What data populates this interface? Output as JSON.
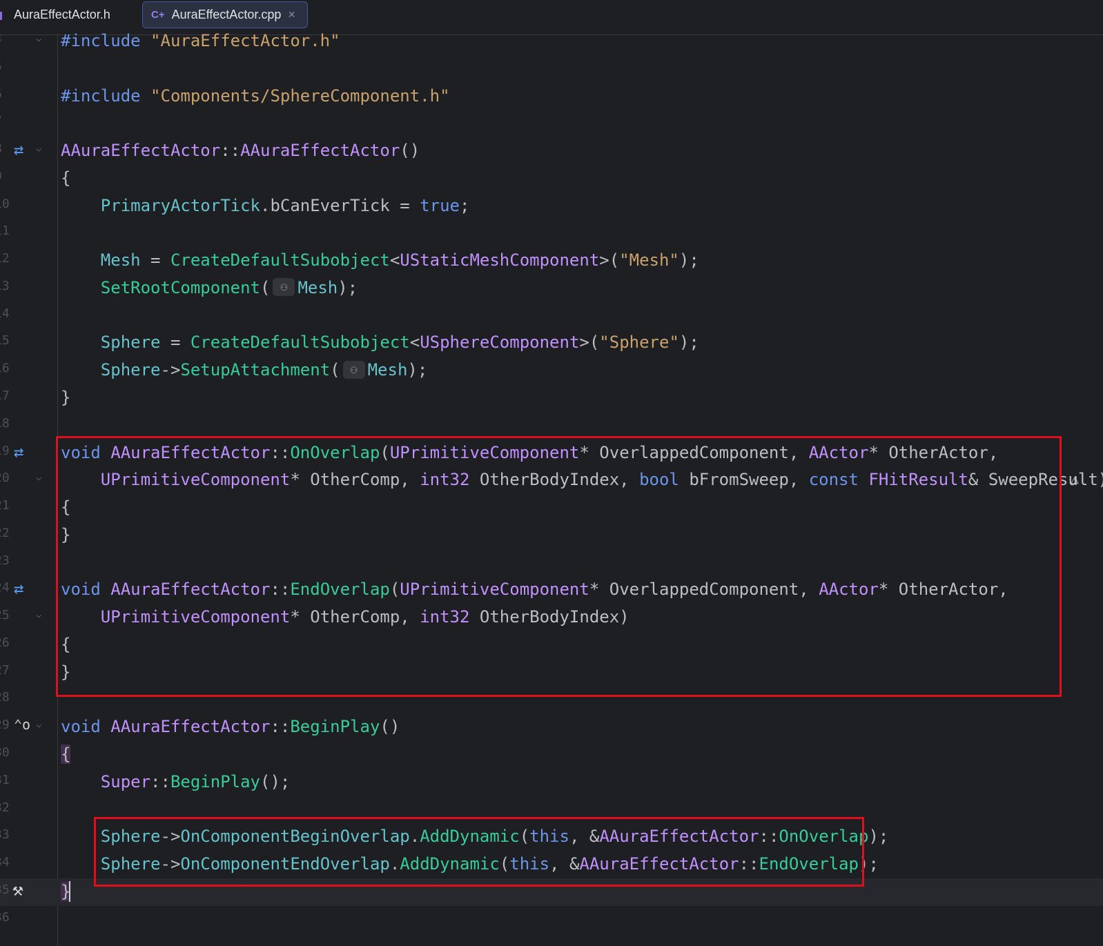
{
  "tabs": [
    {
      "label": "AuraEffectActor.h",
      "icon": "header-file-icon",
      "active": false
    },
    {
      "label": "AuraEffectActor.cpp",
      "icon": "cpp-file-icon",
      "active": true,
      "close": "×",
      "icon_text": "C+"
    }
  ],
  "colors": {
    "keyword": "#6c95eb",
    "type": "#c191ff",
    "function": "#39cc9b",
    "member": "#66c3cc",
    "string": "#c9a26d",
    "highlight_box": "#e00f1e"
  },
  "editor": {
    "lines": [
      {
        "num": "4",
        "fold": true,
        "tokens": [
          [
            "pp",
            "#include "
          ],
          [
            "str",
            "\"AuraEffectActor.h\""
          ]
        ]
      },
      {
        "num": "5",
        "tokens": []
      },
      {
        "num": "6",
        "tokens": [
          [
            "pp",
            "#include "
          ],
          [
            "str",
            "\"Components/SphereComponent.h\""
          ]
        ]
      },
      {
        "num": "7",
        "tokens": []
      },
      {
        "num": "8",
        "gutter": "implements-icon",
        "fold": true,
        "tokens": [
          [
            "ty",
            "AAuraEffectActor"
          ],
          [
            "txt",
            "::"
          ],
          [
            "ty",
            "AAuraEffectActor"
          ],
          [
            "txt",
            "()"
          ]
        ]
      },
      {
        "num": "9",
        "tokens": [
          [
            "txt",
            "{"
          ]
        ]
      },
      {
        "num": "10",
        "tokens": [
          [
            "txt",
            "    "
          ],
          [
            "mem",
            "PrimaryActorTick"
          ],
          [
            "txt",
            "."
          ],
          [
            "prm",
            "bCanEverTick"
          ],
          [
            "txt",
            " = "
          ],
          [
            "kw",
            "true"
          ],
          [
            "txt",
            ";"
          ]
        ]
      },
      {
        "num": "11",
        "tokens": []
      },
      {
        "num": "12",
        "tokens": [
          [
            "txt",
            "    "
          ],
          [
            "mem",
            "Mesh"
          ],
          [
            "txt",
            " = "
          ],
          [
            "fn",
            "CreateDefaultSubobject"
          ],
          [
            "txt",
            "<"
          ],
          [
            "ty",
            "UStaticMeshComponent"
          ],
          [
            "txt",
            ">("
          ],
          [
            "str",
            "\"Mesh\""
          ],
          [
            "txt",
            ");"
          ]
        ]
      },
      {
        "num": "13",
        "tokens": [
          [
            "txt",
            "    "
          ],
          [
            "fn",
            "SetRootComponent"
          ],
          [
            "txt",
            "("
          ],
          [
            "hint",
            "⚇"
          ],
          [
            "mem",
            "Mesh"
          ],
          [
            "txt",
            ");"
          ]
        ]
      },
      {
        "num": "14",
        "tokens": []
      },
      {
        "num": "15",
        "tokens": [
          [
            "txt",
            "    "
          ],
          [
            "mem",
            "Sphere"
          ],
          [
            "txt",
            " = "
          ],
          [
            "fn",
            "CreateDefaultSubobject"
          ],
          [
            "txt",
            "<"
          ],
          [
            "ty",
            "USphereComponent"
          ],
          [
            "txt",
            ">("
          ],
          [
            "str",
            "\"Sphere\""
          ],
          [
            "txt",
            ");"
          ]
        ]
      },
      {
        "num": "16",
        "tokens": [
          [
            "txt",
            "    "
          ],
          [
            "mem",
            "Sphere"
          ],
          [
            "txt",
            "->"
          ],
          [
            "fn",
            "SetupAttachment"
          ],
          [
            "txt",
            "("
          ],
          [
            "hint",
            "⚇"
          ],
          [
            "mem",
            "Mesh"
          ],
          [
            "txt",
            ");"
          ]
        ]
      },
      {
        "num": "17",
        "tokens": [
          [
            "txt",
            "}"
          ]
        ]
      },
      {
        "num": "18",
        "tokens": []
      },
      {
        "num": "19",
        "gutter": "implements-icon",
        "tokens": [
          [
            "kw",
            "void "
          ],
          [
            "ty",
            "AAuraEffectActor"
          ],
          [
            "txt",
            "::"
          ],
          [
            "fn",
            "OnOverlap"
          ],
          [
            "txt",
            "("
          ],
          [
            "ty",
            "UPrimitiveComponent"
          ],
          [
            "txt",
            "* OverlappedComponent, "
          ],
          [
            "ty",
            "AActor"
          ],
          [
            "txt",
            "* OtherActor,"
          ]
        ]
      },
      {
        "num": "20",
        "fold": true,
        "tokens": [
          [
            "txt",
            "    "
          ],
          [
            "ty",
            "UPrimitiveComponent"
          ],
          [
            "txt",
            "* OtherComp, "
          ],
          [
            "ty",
            "int32"
          ],
          [
            "txt",
            " OtherBodyIndex, "
          ],
          [
            "kw",
            "bool"
          ],
          [
            "txt",
            " bFromSweep, "
          ],
          [
            "kw",
            "const "
          ],
          [
            "ty",
            "FHitResult"
          ],
          [
            "txt",
            "& SweepResult)"
          ]
        ]
      },
      {
        "num": "21",
        "tokens": [
          [
            "txt",
            "{"
          ]
        ]
      },
      {
        "num": "22",
        "tokens": [
          [
            "txt",
            "}"
          ]
        ]
      },
      {
        "num": "23",
        "tokens": []
      },
      {
        "num": "24",
        "gutter": "implements-icon",
        "tokens": [
          [
            "kw",
            "void "
          ],
          [
            "ty",
            "AAuraEffectActor"
          ],
          [
            "txt",
            "::"
          ],
          [
            "fn",
            "EndOverlap"
          ],
          [
            "txt",
            "("
          ],
          [
            "ty",
            "UPrimitiveComponent"
          ],
          [
            "txt",
            "* OverlappedComponent, "
          ],
          [
            "ty",
            "AActor"
          ],
          [
            "txt",
            "* OtherActor,"
          ]
        ]
      },
      {
        "num": "25",
        "fold": true,
        "tokens": [
          [
            "txt",
            "    "
          ],
          [
            "ty",
            "UPrimitiveComponent"
          ],
          [
            "txt",
            "* OtherComp, "
          ],
          [
            "ty",
            "int32"
          ],
          [
            "txt",
            " OtherBodyIndex)"
          ]
        ]
      },
      {
        "num": "26",
        "tokens": [
          [
            "txt",
            "{"
          ]
        ]
      },
      {
        "num": "27",
        "tokens": [
          [
            "txt",
            "}"
          ]
        ]
      },
      {
        "num": "28",
        "tokens": []
      },
      {
        "num": "29",
        "gutter": "override-icon",
        "fold": true,
        "tokens": [
          [
            "kw",
            "void "
          ],
          [
            "ty",
            "AAuraEffectActor"
          ],
          [
            "txt",
            "::"
          ],
          [
            "fn",
            "BeginPlay"
          ],
          [
            "txt",
            "()"
          ]
        ]
      },
      {
        "num": "30",
        "tokens": [
          [
            "brace",
            "{"
          ]
        ]
      },
      {
        "num": "31",
        "tokens": [
          [
            "txt",
            "    "
          ],
          [
            "ty",
            "Super"
          ],
          [
            "txt",
            "::"
          ],
          [
            "fn",
            "BeginPlay"
          ],
          [
            "txt",
            "();"
          ]
        ]
      },
      {
        "num": "32",
        "tokens": []
      },
      {
        "num": "33",
        "tokens": [
          [
            "txt",
            "    "
          ],
          [
            "mem",
            "Sphere"
          ],
          [
            "txt",
            "->"
          ],
          [
            "mem",
            "OnComponentBeginOverlap"
          ],
          [
            "txt",
            "."
          ],
          [
            "fn",
            "AddDynamic"
          ],
          [
            "txt",
            "("
          ],
          [
            "kw",
            "this"
          ],
          [
            "txt",
            ", &"
          ],
          [
            "ty",
            "AAuraEffectActor"
          ],
          [
            "txt",
            "::"
          ],
          [
            "fn",
            "OnOverlap"
          ],
          [
            "txt",
            ");"
          ]
        ]
      },
      {
        "num": "34",
        "tokens": [
          [
            "txt",
            "    "
          ],
          [
            "mem",
            "Sphere"
          ],
          [
            "txt",
            "->"
          ],
          [
            "mem",
            "OnComponentEndOverlap"
          ],
          [
            "txt",
            "."
          ],
          [
            "fn",
            "AddDynamic"
          ],
          [
            "txt",
            "("
          ],
          [
            "kw",
            "this"
          ],
          [
            "txt",
            ", &"
          ],
          [
            "ty",
            "AAuraEffectActor"
          ],
          [
            "txt",
            "::"
          ],
          [
            "fn",
            "EndOverlap"
          ],
          [
            "txt",
            ");"
          ]
        ]
      },
      {
        "num": "35",
        "gutter": "hammer-icon",
        "current": true,
        "tokens": [
          [
            "brace",
            "}"
          ],
          [
            "caret",
            ""
          ]
        ]
      },
      {
        "num": "36",
        "tokens": []
      }
    ]
  }
}
